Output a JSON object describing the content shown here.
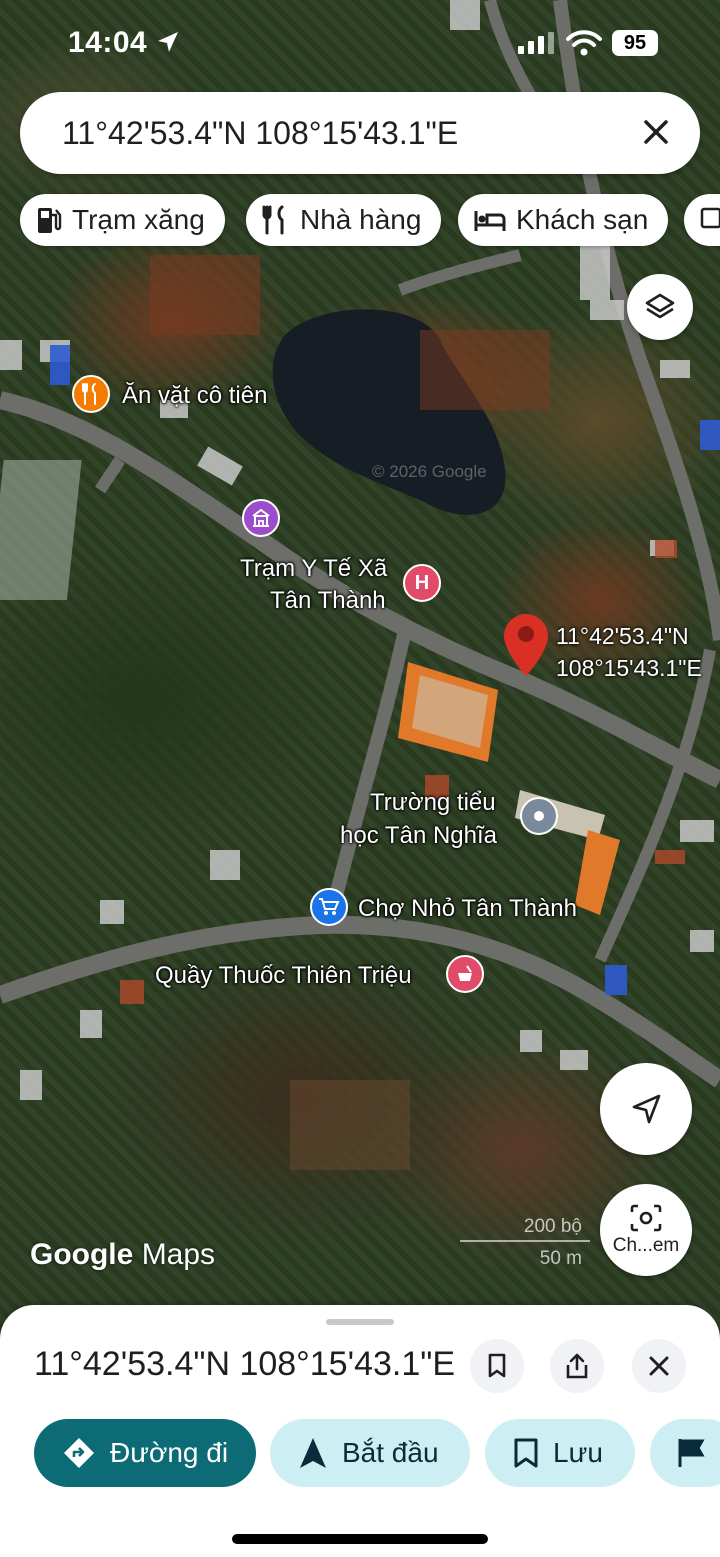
{
  "status_bar": {
    "time": "14:04",
    "battery": "95"
  },
  "search": {
    "query": "11°42'53.4\"N 108°15'43.1\"E"
  },
  "chips": [
    {
      "label": "Trạm xăng",
      "icon": "gas-station-icon"
    },
    {
      "label": "Nhà hàng",
      "icon": "restaurant-icon"
    },
    {
      "label": "Khách sạn",
      "icon": "hotel-icon"
    }
  ],
  "map": {
    "watermark": "© 2026 Google",
    "pois": {
      "an_vat": "Ăn vặt cô tiên",
      "tram_y_te_1": "Trạm Y Tế Xã",
      "tram_y_te_2": "Tân Thành",
      "truong_1": "Trường tiểu",
      "truong_2": "học Tân Nghĩa",
      "cho": "Chợ Nhỏ Tân Thành",
      "quay_thuoc": "Quầy Thuốc Thiên Triệu"
    },
    "pin": {
      "lat": "11°42'53.4\"N",
      "lng": "108°15'43.1\"E"
    },
    "brand_google": "Google",
    "brand_maps": "Maps",
    "scale_ft": "200 bộ",
    "scale_m": "50 m",
    "lens_label": "Ch...em"
  },
  "sheet": {
    "title": "11°42'53.4\"N 108°15'43.1\"E",
    "actions": {
      "directions": "Đường đi",
      "start": "Bắt đầu",
      "save": "Lưu"
    }
  },
  "colors": {
    "primary": "#0c6b74",
    "secondary": "#cdeff3",
    "pin": "#d93025",
    "poi_food": "#f57c00",
    "poi_health": "#e24a6a",
    "poi_shop": "#1a73e8",
    "poi_school": "#7a8a9a",
    "poi_gov": "#9c4dcc"
  }
}
